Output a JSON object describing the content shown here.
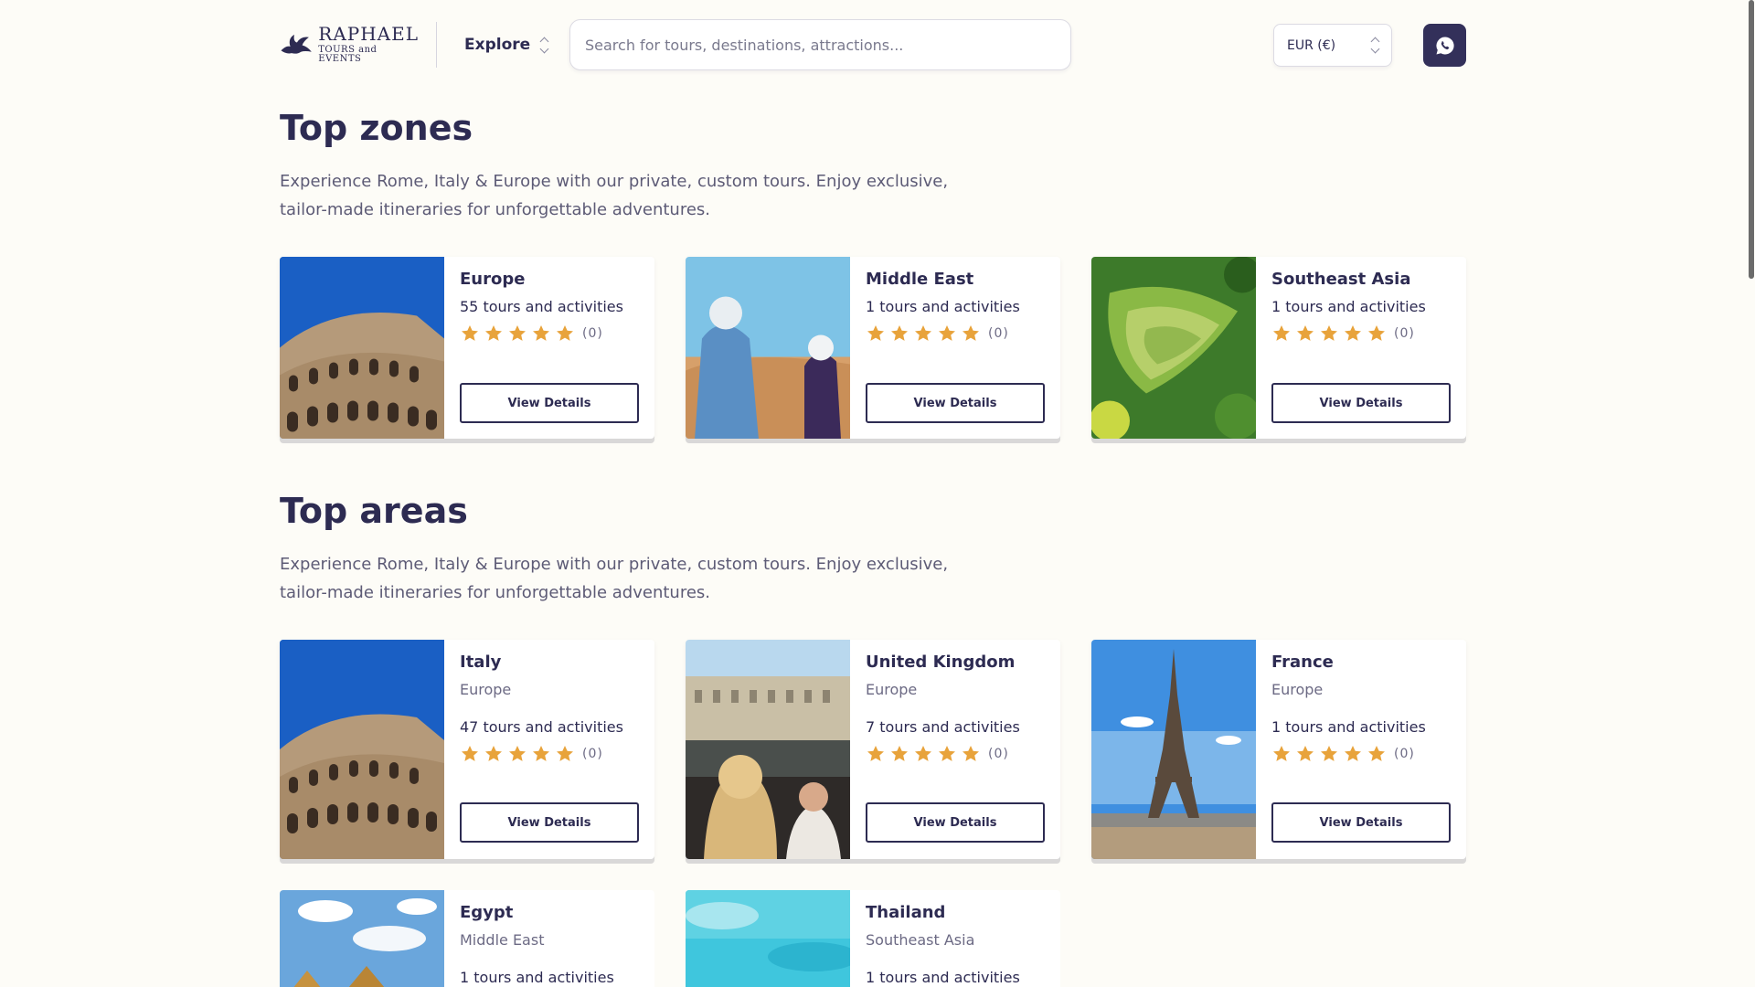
{
  "header": {
    "logo": {
      "name": "RAPHAEL",
      "tagline": "TOURS and EVENTS"
    },
    "explore_label": "Explore",
    "search_placeholder": "Search for tours, destinations, attractions...",
    "currency_label": "EUR (€)",
    "whatsapp_icon": "whatsapp-icon"
  },
  "colors": {
    "background": "#fdfcf7",
    "primary": "#2d2b52",
    "star": "#e8a33b",
    "whatsapp_button": "#33305a"
  },
  "zones": {
    "title": "Top zones",
    "description": "Experience Rome, Italy & Europe with our private, custom tours. Enjoy exclusive, tailor-made itineraries for unforgettable adventures.",
    "cards": [
      {
        "name": "Europe",
        "count": "55 tours and activities",
        "rating_count": "(0)",
        "button": "View Details",
        "image": "colosseum"
      },
      {
        "name": "Middle East",
        "count": "1 tours and activities",
        "rating_count": "(0)",
        "button": "View Details",
        "image": "desert"
      },
      {
        "name": "Southeast Asia",
        "count": "1 tours and activities",
        "rating_count": "(0)",
        "button": "View Details",
        "image": "rice-terraces"
      }
    ]
  },
  "areas": {
    "title": "Top areas",
    "description": "Experience Rome, Italy & Europe with our private, custom tours. Enjoy exclusive, tailor-made itineraries for unforgettable adventures.",
    "cards": [
      {
        "name": "Italy",
        "region": "Europe",
        "count": "47 tours and activities",
        "rating_count": "(0)",
        "button": "View Details",
        "image": "colosseum"
      },
      {
        "name": "United Kingdom",
        "region": "Europe",
        "count": "7 tours and activities",
        "rating_count": "(0)",
        "button": "View Details",
        "image": "buckingham-palace"
      },
      {
        "name": "France",
        "region": "Europe",
        "count": "1 tours and activities",
        "rating_count": "(0)",
        "button": "View Details",
        "image": "eiffel-tower"
      },
      {
        "name": "Egypt",
        "region": "Middle East",
        "count": "1 tours and activities",
        "image": "pyramids"
      },
      {
        "name": "Thailand",
        "region": "Southeast Asia",
        "count": "1 tours and activities",
        "image": "tropical-sea"
      }
    ]
  }
}
